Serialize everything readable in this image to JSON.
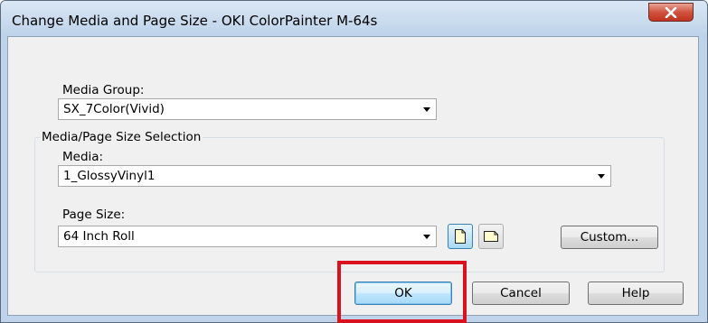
{
  "window": {
    "title": "Change Media and Page Size - OKI ColorPainter M-64s"
  },
  "media_group": {
    "label": "Media Group:",
    "value": "SX_7Color(Vivid)"
  },
  "group": {
    "label": "Media/Page Size Selection"
  },
  "media": {
    "label": "Media:",
    "value": "1_GlossyVinyl1"
  },
  "page_size": {
    "label": "Page Size:",
    "value": "64 Inch Roll",
    "orientation_buttons": [
      "portrait-icon",
      "landscape-icon"
    ]
  },
  "buttons": {
    "custom": "Custom...",
    "ok": "OK",
    "cancel": "Cancel",
    "help": "Help"
  },
  "annotation": {
    "highlight_color": "#d9121d",
    "highlighted": "ok-button"
  }
}
